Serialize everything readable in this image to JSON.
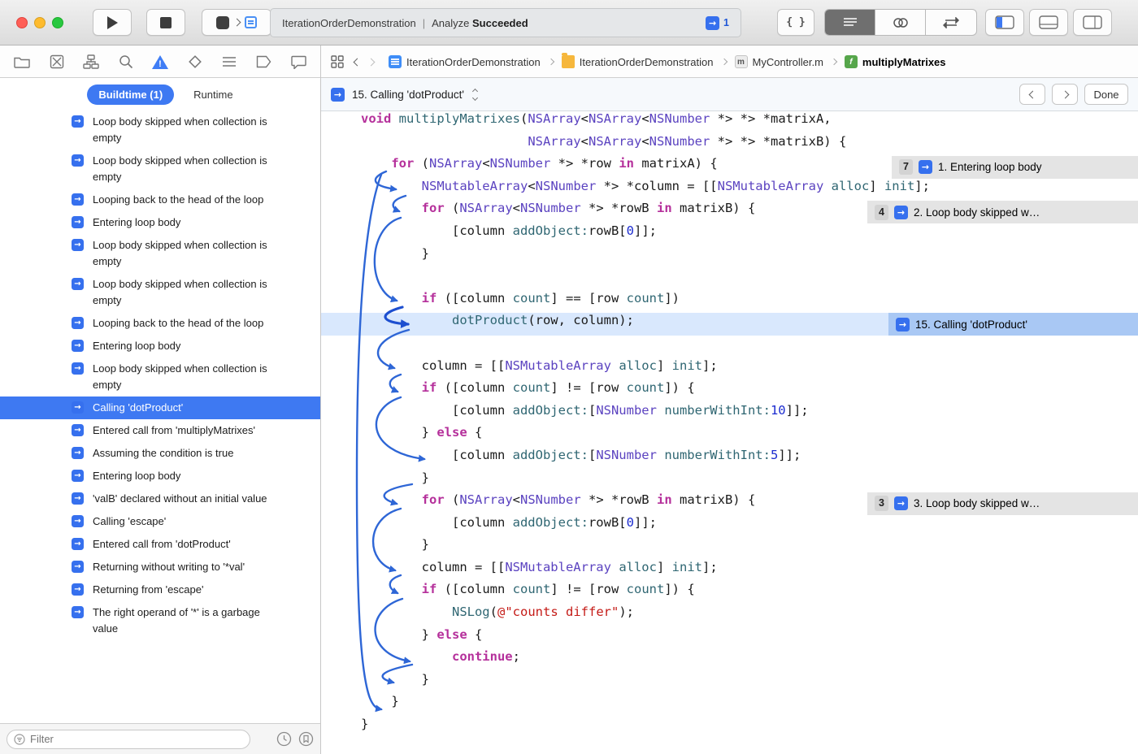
{
  "accent": {
    "blue": "#3e79f2"
  },
  "icons": [
    "close-icon",
    "minimize-icon",
    "zoom-icon",
    "play-icon",
    "stop-icon",
    "scheme-icon",
    "analyzer-arrow-icon",
    "brace-icon",
    "standard-editor-icon",
    "assistant-editor-icon",
    "version-editor-icon",
    "left-panel-icon",
    "bottom-panel-icon",
    "right-panel-icon",
    "project-navigator-icon",
    "source-control-icon",
    "symbol-navigator-icon",
    "search-icon",
    "issue-navigator-icon",
    "test-navigator-icon",
    "debug-navigator-icon",
    "breakpoint-navigator-icon",
    "report-navigator-icon",
    "related-items-icon",
    "chevron-left-icon",
    "chevron-right-icon",
    "filter-icon",
    "clock-icon",
    "flag-filter-icon"
  ],
  "toolbar": {
    "status_project": "IterationOrderDemonstration",
    "status_divider": "|",
    "status_action": "Analyze",
    "status_result": "Succeeded",
    "issue_count": "1",
    "brace_button_label": "{ }"
  },
  "jumpbar": {
    "crumbs": [
      {
        "icon": "project-icon",
        "label": "IterationOrderDemonstration",
        "glyph": ""
      },
      {
        "icon": "folder-icon",
        "label": "IterationOrderDemonstration",
        "glyph": ""
      },
      {
        "icon": "file-m-icon",
        "label": "MyController.m",
        "glyph": "m"
      },
      {
        "icon": "function-icon",
        "label": "multiplyMatrixes",
        "glyph": "f"
      }
    ]
  },
  "sidebar": {
    "tabs": [
      {
        "label": "Buildtime (1)",
        "active": true
      },
      {
        "label": "Runtime",
        "active": false
      }
    ],
    "items": [
      {
        "label": "Loop body skipped when collection is empty"
      },
      {
        "label": "Loop body skipped when collection is empty"
      },
      {
        "label": "Looping back to the head of the loop"
      },
      {
        "label": "Entering loop body"
      },
      {
        "label": "Loop body skipped when collection is empty"
      },
      {
        "label": "Loop body skipped when collection is empty"
      },
      {
        "label": "Looping back to the head of the loop"
      },
      {
        "label": "Entering loop body"
      },
      {
        "label": "Loop body skipped when collection is empty"
      },
      {
        "label": "Calling 'dotProduct'",
        "selected": true
      },
      {
        "label": "Entered call from 'multiplyMatrixes'"
      },
      {
        "label": "Assuming the condition is true"
      },
      {
        "label": "Entering loop body"
      },
      {
        "label": "'valB' declared without an initial value"
      },
      {
        "label": "Calling 'escape'"
      },
      {
        "label": "Entered call from 'dotProduct'"
      },
      {
        "label": "Returning without writing to '*val'"
      },
      {
        "label": "Returning from 'escape'"
      },
      {
        "label": "The right operand of '*' is a garbage value"
      }
    ],
    "filter_placeholder": "Filter"
  },
  "stepbar": {
    "label": "15. Calling 'dotProduct'",
    "done": "Done"
  },
  "code": {
    "lines": [
      {
        "s": [
          [
            "k",
            "void"
          ],
          [
            "p",
            " "
          ],
          [
            "f",
            "multiplyMatrixes"
          ],
          [
            "p",
            "("
          ],
          [
            "t",
            "NSArray"
          ],
          [
            "p",
            "<"
          ],
          [
            "t",
            "NSArray"
          ],
          [
            "p",
            "<"
          ],
          [
            "t",
            "NSNumber"
          ],
          [
            "p",
            " *> *> *matrixA,"
          ]
        ]
      },
      {
        "s": [
          [
            "p",
            "                      "
          ],
          [
            "t",
            "NSArray"
          ],
          [
            "p",
            "<"
          ],
          [
            "t",
            "NSArray"
          ],
          [
            "p",
            "<"
          ],
          [
            "t",
            "NSNumber"
          ],
          [
            "p",
            " *> *> *matrixB) {"
          ]
        ]
      },
      {
        "s": [
          [
            "p",
            "    "
          ],
          [
            "k",
            "for"
          ],
          [
            "p",
            " ("
          ],
          [
            "t",
            "NSArray"
          ],
          [
            "p",
            "<"
          ],
          [
            "t",
            "NSNumber"
          ],
          [
            "p",
            " *> *row "
          ],
          [
            "k",
            "in"
          ],
          [
            "p",
            " matrixA) {"
          ]
        ],
        "a": {
          "b": "7",
          "t": "1. Entering loop body",
          "k": "gray",
          "l": 702
        }
      },
      {
        "s": [
          [
            "p",
            "        "
          ],
          [
            "t",
            "NSMutableArray"
          ],
          [
            "p",
            "<"
          ],
          [
            "t",
            "NSNumber"
          ],
          [
            "p",
            " *> *column = [["
          ],
          [
            "t",
            "NSMutableArray"
          ],
          [
            "p",
            " "
          ],
          [
            "f",
            "alloc"
          ],
          [
            "p",
            "] "
          ],
          [
            "f",
            "init"
          ],
          [
            "p",
            "];"
          ]
        ]
      },
      {
        "s": [
          [
            "p",
            "        "
          ],
          [
            "k",
            "for"
          ],
          [
            "p",
            " ("
          ],
          [
            "t",
            "NSArray"
          ],
          [
            "p",
            "<"
          ],
          [
            "t",
            "NSNumber"
          ],
          [
            "p",
            " *> *rowB "
          ],
          [
            "k",
            "in"
          ],
          [
            "p",
            " matrixB) {"
          ]
        ],
        "a": {
          "b": "4",
          "t": "2. Loop body skipped w…",
          "k": "gray",
          "l": 672
        }
      },
      {
        "s": [
          [
            "p",
            "            [column "
          ],
          [
            "f",
            "addObject:"
          ],
          [
            "p",
            "rowB["
          ],
          [
            "n",
            "0"
          ],
          [
            "p",
            "]];"
          ]
        ]
      },
      {
        "s": [
          [
            "p",
            "        }"
          ]
        ]
      },
      {
        "s": []
      },
      {
        "s": [
          [
            "p",
            "        "
          ],
          [
            "k",
            "if"
          ],
          [
            "p",
            " ([column "
          ],
          [
            "f",
            "count"
          ],
          [
            "p",
            "] == [row "
          ],
          [
            "f",
            "count"
          ],
          [
            "p",
            "])"
          ]
        ]
      },
      {
        "s": [
          [
            "p",
            "            "
          ],
          [
            "f",
            "dotProduct"
          ],
          [
            "p",
            "(row, column);"
          ]
        ],
        "h": true,
        "a": {
          "t": "15. Calling 'dotProduct'",
          "k": "blue",
          "l": 698
        }
      },
      {
        "s": []
      },
      {
        "s": [
          [
            "p",
            "        column = [["
          ],
          [
            "t",
            "NSMutableArray"
          ],
          [
            "p",
            " "
          ],
          [
            "f",
            "alloc"
          ],
          [
            "p",
            "] "
          ],
          [
            "f",
            "init"
          ],
          [
            "p",
            "];"
          ]
        ]
      },
      {
        "s": [
          [
            "p",
            "        "
          ],
          [
            "k",
            "if"
          ],
          [
            "p",
            " ([column "
          ],
          [
            "f",
            "count"
          ],
          [
            "p",
            "] != [row "
          ],
          [
            "f",
            "count"
          ],
          [
            "p",
            "]) {"
          ]
        ]
      },
      {
        "s": [
          [
            "p",
            "            [column "
          ],
          [
            "f",
            "addObject:"
          ],
          [
            "p",
            "["
          ],
          [
            "t",
            "NSNumber"
          ],
          [
            "p",
            " "
          ],
          [
            "f",
            "numberWithInt:"
          ],
          [
            "n",
            "10"
          ],
          [
            "p",
            "]];"
          ]
        ]
      },
      {
        "s": [
          [
            "p",
            "        } "
          ],
          [
            "k",
            "else"
          ],
          [
            "p",
            " {"
          ]
        ]
      },
      {
        "s": [
          [
            "p",
            "            [column "
          ],
          [
            "f",
            "addObject:"
          ],
          [
            "p",
            "["
          ],
          [
            "t",
            "NSNumber"
          ],
          [
            "p",
            " "
          ],
          [
            "f",
            "numberWithInt:"
          ],
          [
            "n",
            "5"
          ],
          [
            "p",
            "]];"
          ]
        ]
      },
      {
        "s": [
          [
            "p",
            "        }"
          ]
        ]
      },
      {
        "s": [
          [
            "p",
            "        "
          ],
          [
            "k",
            "for"
          ],
          [
            "p",
            " ("
          ],
          [
            "t",
            "NSArray"
          ],
          [
            "p",
            "<"
          ],
          [
            "t",
            "NSNumber"
          ],
          [
            "p",
            " *> *rowB "
          ],
          [
            "k",
            "in"
          ],
          [
            "p",
            " matrixB) {"
          ]
        ],
        "a": {
          "b": "3",
          "t": "3. Loop body skipped w…",
          "k": "gray",
          "l": 672
        }
      },
      {
        "s": [
          [
            "p",
            "            [column "
          ],
          [
            "f",
            "addObject:"
          ],
          [
            "p",
            "rowB["
          ],
          [
            "n",
            "0"
          ],
          [
            "p",
            "]];"
          ]
        ]
      },
      {
        "s": [
          [
            "p",
            "        }"
          ]
        ]
      },
      {
        "s": [
          [
            "p",
            "        column = [["
          ],
          [
            "t",
            "NSMutableArray"
          ],
          [
            "p",
            " "
          ],
          [
            "f",
            "alloc"
          ],
          [
            "p",
            "] "
          ],
          [
            "f",
            "init"
          ],
          [
            "p",
            "];"
          ]
        ]
      },
      {
        "s": [
          [
            "p",
            "        "
          ],
          [
            "k",
            "if"
          ],
          [
            "p",
            " ([column "
          ],
          [
            "f",
            "count"
          ],
          [
            "p",
            "] != [row "
          ],
          [
            "f",
            "count"
          ],
          [
            "p",
            "]) {"
          ]
        ]
      },
      {
        "s": [
          [
            "p",
            "            "
          ],
          [
            "f",
            "NSLog"
          ],
          [
            "p",
            "("
          ],
          [
            "s",
            "@\"counts differ\""
          ],
          [
            "p",
            ");"
          ]
        ]
      },
      {
        "s": [
          [
            "p",
            "        } "
          ],
          [
            "k",
            "else"
          ],
          [
            "p",
            " {"
          ]
        ]
      },
      {
        "s": [
          [
            "p",
            "            "
          ],
          [
            "k",
            "continue"
          ],
          [
            "p",
            ";"
          ]
        ]
      },
      {
        "s": [
          [
            "p",
            "        }"
          ]
        ]
      },
      {
        "s": [
          [
            "p",
            "    }"
          ]
        ]
      },
      {
        "s": [
          [
            "p",
            "}"
          ]
        ]
      }
    ]
  }
}
